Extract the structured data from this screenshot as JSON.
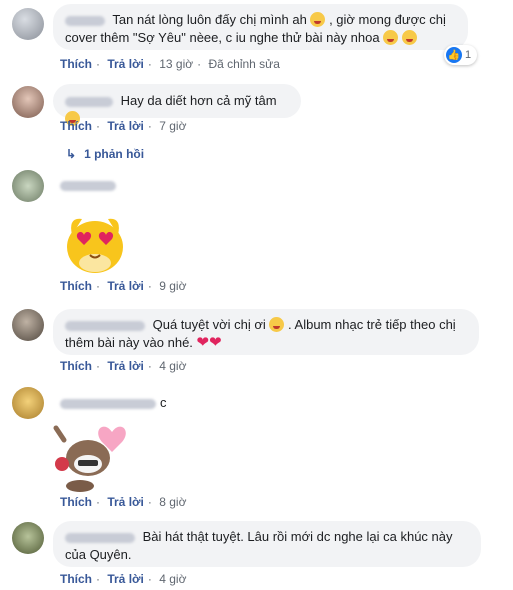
{
  "actions": {
    "like": "Thích",
    "reply": "Trả lời",
    "edited": "Đã chỉnh sửa"
  },
  "comments": [
    {
      "text_1": "Tan nát lòng luôn đấy chị mình ah",
      "text_2": ", giờ mong được chị",
      "text_3": "cover thêm \"Sợ Yêu\" nèee, c iu nghe thử bài này nhoa",
      "time": "13 giờ",
      "reaction_count": "1"
    },
    {
      "text": "Hay da diết hơn cả mỹ tâm",
      "time": "7 giờ",
      "replies": "1 phản hồi"
    },
    {
      "time": "9 giờ"
    },
    {
      "text_1": "Quá tuyệt vời chị ơi",
      "text_2": ". Album nhạc trẻ tiếp theo chị",
      "text_3": "thêm bài này vào nhé.",
      "time": "4 giờ"
    },
    {
      "suffix": "c",
      "time": "8 giờ"
    },
    {
      "text_1": "Bài hát thật tuyệt. Lâu rồi mới dc nghe lại ca khúc này",
      "text_2": "của Quyên.",
      "time": "4 giờ"
    }
  ],
  "colors": {
    "link": "#385898",
    "bubble": "#f2f3f5",
    "meta": "#606770"
  }
}
